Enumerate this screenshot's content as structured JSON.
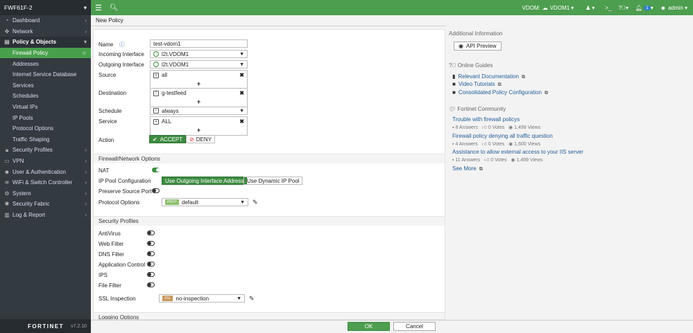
{
  "device_name": "FWF61F-2",
  "sidebar": {
    "items": [
      {
        "label": "Dashboard",
        "icon": "dashboard-icon",
        "has_chevron": true
      },
      {
        "label": "Network",
        "icon": "network-icon",
        "has_chevron": true
      },
      {
        "label": "Policy & Objects",
        "icon": "policy-icon",
        "has_chevron": true,
        "expanded": true
      }
    ],
    "subitems": [
      "Firewall Policy",
      "Addresses",
      "Internet Service Database",
      "Services",
      "Schedules",
      "Virtual IPs",
      "IP Pools",
      "Protocol Options",
      "Traffic Shaping"
    ],
    "items2": [
      {
        "label": "Security Profiles",
        "icon": "lock-icon"
      },
      {
        "label": "VPN",
        "icon": "vpn-icon"
      },
      {
        "label": "User & Authentication",
        "icon": "user-icon"
      },
      {
        "label": "WiFi & Switch Controller",
        "icon": "wifi-icon"
      },
      {
        "label": "System",
        "icon": "gear-icon"
      },
      {
        "label": "Security Fabric",
        "icon": "fabric-icon"
      },
      {
        "label": "Log & Report",
        "icon": "chart-icon"
      }
    ],
    "footer_logo": "FORTINET",
    "version": "v7.2.10"
  },
  "topbar": {
    "vdom_label": "VDOM:",
    "vdom_value": "VDOM1",
    "notifications": "1",
    "user": "admin"
  },
  "page_title": "New Policy",
  "form": {
    "name_label": "Name",
    "name_value": "test-vdom1",
    "incoming_label": "Incoming Interface",
    "incoming_value": "l2t.VDOM1",
    "outgoing_label": "Outgoing Interface",
    "outgoing_value": "l2t.VDOM1",
    "source_label": "Source",
    "source_value": "all",
    "destination_label": "Destination",
    "destination_value": "g-testfeed",
    "schedule_label": "Schedule",
    "schedule_value": "always",
    "service_label": "Service",
    "service_value": "ALL",
    "action_label": "Action",
    "accept_label": "ACCEPT",
    "deny_label": "DENY",
    "plus": "+",
    "fwnet_header": "Firewall/Network Options",
    "nat_label": "NAT",
    "nat_on": true,
    "ippool_label": "IP Pool Configuration",
    "ippool_opt1": "Use Outgoing Interface Address",
    "ippool_opt2": "Use Dynamic IP Pool",
    "preserve_label": "Preserve Source Port",
    "protocol_label": "Protocol Options",
    "protocol_tag": "PROT",
    "protocol_value": "default",
    "secprof_header": "Security Profiles",
    "profiles": [
      "AntiVirus",
      "Web Filter",
      "DNS Filter",
      "Application Control",
      "IPS",
      "File Filter"
    ],
    "ssl_label": "SSL Inspection",
    "ssl_tag": "SSL",
    "ssl_value": "no-inspection",
    "logging_header": "Logging Options"
  },
  "right": {
    "additional_info": "Additional Information",
    "api_preview": "API Preview",
    "online_guides": "Online Guides",
    "guides": [
      "Relevant Documentation",
      "Video Tutorials",
      "Consolidated Policy Configuration"
    ],
    "community": "Fortinet Community",
    "threads": [
      {
        "title": "Trouble with firewall policys",
        "answers": "8 Answers",
        "votes": "0 Votes",
        "views": "1,499 Views"
      },
      {
        "title": "Firewall policy denying all traffic question",
        "answers": "4 Answers",
        "votes": "0 Votes",
        "views": "1,600 Views"
      },
      {
        "title": "Assistance to allow external access to your IIS server",
        "answers": "11 Answers",
        "votes": "0 Votes",
        "views": "1,499 Views"
      }
    ],
    "see_more": "See More"
  },
  "buttons": {
    "ok": "OK",
    "cancel": "Cancel"
  },
  "colors": {
    "accent": "#4d9e4f",
    "sidebar": "#333a40",
    "link": "#1f5c99"
  }
}
